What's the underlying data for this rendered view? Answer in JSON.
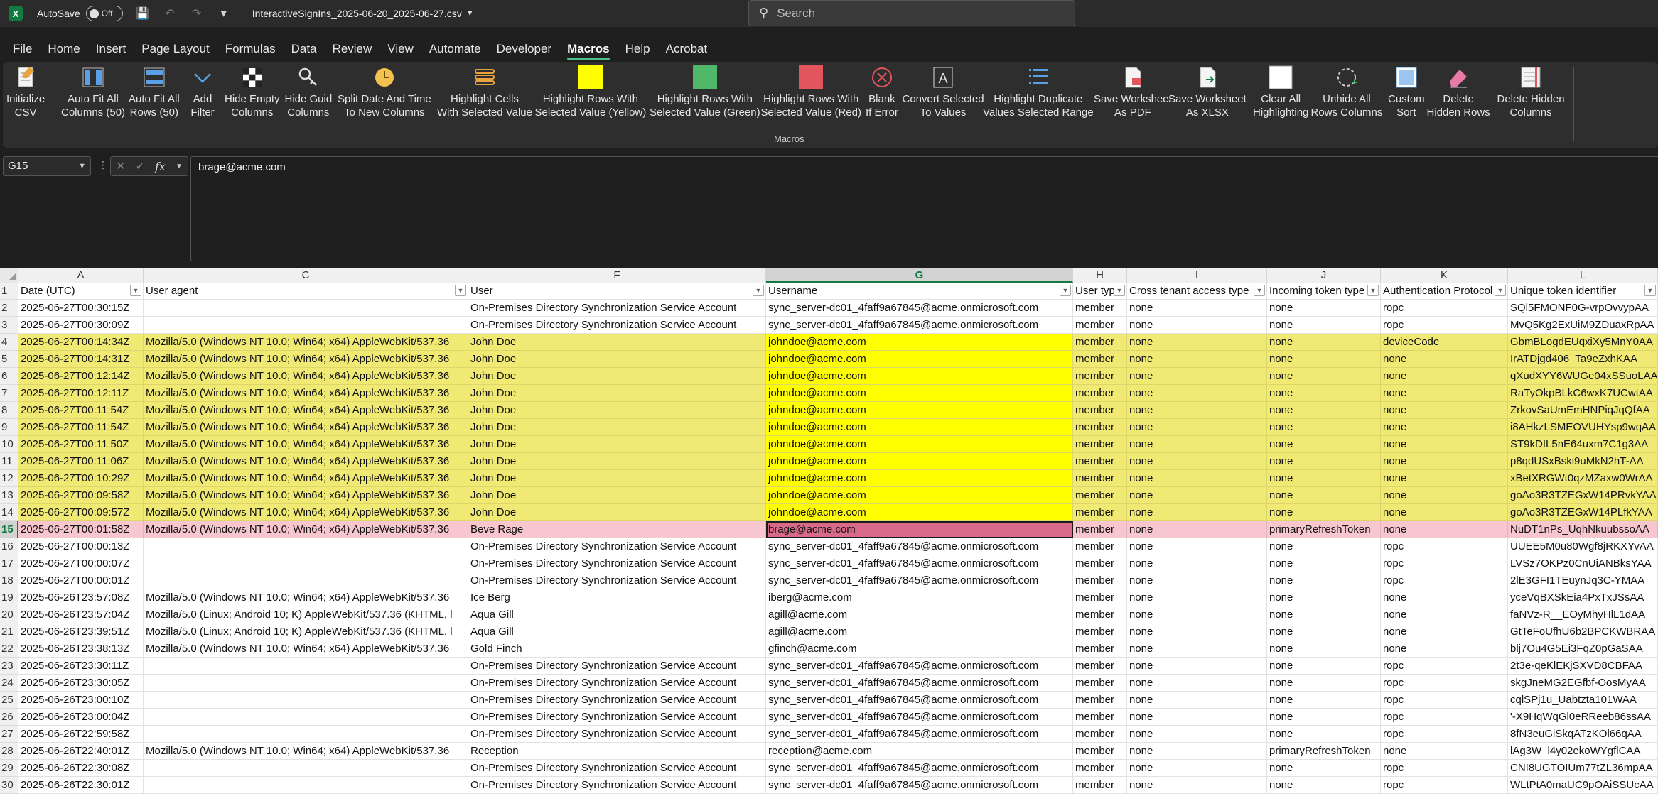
{
  "titlebar": {
    "autosave_label": "AutoSave",
    "autosave_state": "Off",
    "filename": "InteractiveSignIns_2025-06-20_2025-06-27.csv",
    "search_placeholder": "Search"
  },
  "menu": [
    "File",
    "Home",
    "Insert",
    "Page Layout",
    "Formulas",
    "Data",
    "Review",
    "View",
    "Automate",
    "Developer",
    "Macros",
    "Help",
    "Acrobat"
  ],
  "menu_active": "Macros",
  "ribbon": {
    "group_label": "Macros",
    "buttons": [
      {
        "label": "Initialize\nCSV",
        "icon": "doc-initialize-icon"
      },
      {
        "label": "Auto Fit All\nColumns (50)",
        "icon": "fit-columns-icon"
      },
      {
        "label": "Auto Fit All\nRows (50)",
        "icon": "fit-rows-icon"
      },
      {
        "label": "Add\nFilter",
        "icon": "filter-chevron-icon"
      },
      {
        "label": "Hide Empty\nColumns",
        "icon": "checker-icon"
      },
      {
        "label": "Hide Guid\nColumns",
        "icon": "key-icon"
      },
      {
        "label": "Split Date And Time\nTo New Columns",
        "icon": "clock-icon"
      },
      {
        "label": "Highlight Cells\nWith Selected Value",
        "icon": "stack-icon"
      },
      {
        "label": "Highlight Rows With\nSelected Value (Yellow)",
        "icon": "yellow-square-icon"
      },
      {
        "label": "Highlight Rows With\nSelected Value (Green)",
        "icon": "green-square-icon"
      },
      {
        "label": "Highlight Rows With\nSelected Value (Red)",
        "icon": "red-square-icon"
      },
      {
        "label": "Blank\nIf Error",
        "icon": "error-circle-icon"
      },
      {
        "label": "Convert Selected\nTo Values",
        "icon": "text-a-icon"
      },
      {
        "label": "Highlight Duplicate\nValues Selected Range",
        "icon": "list-dup-icon"
      },
      {
        "label": "Save Worksheet\nAs PDF",
        "icon": "pdf-doc-icon"
      },
      {
        "label": "Save Worksheet\nAs XLSX",
        "icon": "xlsx-doc-icon"
      },
      {
        "label": "Clear All\nHighlighting",
        "icon": "blank-square-icon"
      },
      {
        "label": "Unhide All\nRows Columns",
        "icon": "unhide-icon"
      },
      {
        "label": "Custom\nSort",
        "icon": "sort-grid-icon"
      },
      {
        "label": "Delete\nHidden Rows",
        "icon": "eraser-icon"
      },
      {
        "label": "Delete Hidden\nColumns",
        "icon": "sheet-delete-icon"
      }
    ]
  },
  "formula_bar": {
    "name_box": "G15",
    "formula": "brage@acme.com",
    "fx_label": "fx"
  },
  "columns": [
    {
      "letter": "A",
      "header": "Date (UTC)"
    },
    {
      "letter": "C",
      "header": "User agent"
    },
    {
      "letter": "F",
      "header": "User"
    },
    {
      "letter": "G",
      "header": "Username"
    },
    {
      "letter": "H",
      "header": "User type"
    },
    {
      "letter": "I",
      "header": "Cross tenant access type"
    },
    {
      "letter": "J",
      "header": "Incoming token type"
    },
    {
      "letter": "K",
      "header": "Authentication Protocol"
    },
    {
      "letter": "L",
      "header": "Unique token identifier"
    }
  ],
  "selected_cell": {
    "row": 15,
    "col": "G"
  },
  "rows": [
    {
      "n": 2,
      "hl": "",
      "cells": [
        "2025-06-27T00:30:15Z",
        "",
        "On-Premises Directory Synchronization Service Account",
        "sync_server-dc01_4faff9a67845@acme.onmicrosoft.com",
        "member",
        "none",
        "none",
        "ropc",
        "SQl5FMONF0G-vrpOvvypAA"
      ]
    },
    {
      "n": 3,
      "hl": "",
      "cells": [
        "2025-06-27T00:30:09Z",
        "",
        "On-Premises Directory Synchronization Service Account",
        "sync_server-dc01_4faff9a67845@acme.onmicrosoft.com",
        "member",
        "none",
        "none",
        "ropc",
        "MvQ5Kg2ExUiM9ZDuaxRpAA"
      ]
    },
    {
      "n": 4,
      "hl": "yellow",
      "cells": [
        "2025-06-27T00:14:34Z",
        "Mozilla/5.0 (Windows NT 10.0; Win64; x64) AppleWebKit/537.36",
        "John Doe",
        "johndoe@acme.com",
        "member",
        "none",
        "none",
        "deviceCode",
        "GbmBLogdEUqxiXy5MnY0AA"
      ]
    },
    {
      "n": 5,
      "hl": "yellow",
      "cells": [
        "2025-06-27T00:14:31Z",
        "Mozilla/5.0 (Windows NT 10.0; Win64; x64) AppleWebKit/537.36",
        "John Doe",
        "johndoe@acme.com",
        "member",
        "none",
        "none",
        "none",
        "IrATDjgd406_Ta9eZxhKAA"
      ]
    },
    {
      "n": 6,
      "hl": "yellow",
      "cells": [
        "2025-06-27T00:12:14Z",
        "Mozilla/5.0 (Windows NT 10.0; Win64; x64) AppleWebKit/537.36",
        "John Doe",
        "johndoe@acme.com",
        "member",
        "none",
        "none",
        "none",
        "qXudXYY6WUGe04xSSuoLAA"
      ]
    },
    {
      "n": 7,
      "hl": "yellow",
      "cells": [
        "2025-06-27T00:12:11Z",
        "Mozilla/5.0 (Windows NT 10.0; Win64; x64) AppleWebKit/537.36",
        "John Doe",
        "johndoe@acme.com",
        "member",
        "none",
        "none",
        "none",
        "RaTyOkpBLkC6wxK7UCwtAA"
      ]
    },
    {
      "n": 8,
      "hl": "yellow",
      "cells": [
        "2025-06-27T00:11:54Z",
        "Mozilla/5.0 (Windows NT 10.0; Win64; x64) AppleWebKit/537.36",
        "John Doe",
        "johndoe@acme.com",
        "member",
        "none",
        "none",
        "none",
        "ZrkovSaUmEmHNPiqJqQfAA"
      ]
    },
    {
      "n": 9,
      "hl": "yellow",
      "cells": [
        "2025-06-27T00:11:54Z",
        "Mozilla/5.0 (Windows NT 10.0; Win64; x64) AppleWebKit/537.36",
        "John Doe",
        "johndoe@acme.com",
        "member",
        "none",
        "none",
        "none",
        "i8AHkzLSMEOVUHYsp9wqAA"
      ]
    },
    {
      "n": 10,
      "hl": "yellow",
      "cells": [
        "2025-06-27T00:11:50Z",
        "Mozilla/5.0 (Windows NT 10.0; Win64; x64) AppleWebKit/537.36",
        "John Doe",
        "johndoe@acme.com",
        "member",
        "none",
        "none",
        "none",
        "ST9kDIL5nE64uxm7C1g3AA"
      ]
    },
    {
      "n": 11,
      "hl": "yellow",
      "cells": [
        "2025-06-27T00:11:06Z",
        "Mozilla/5.0 (Windows NT 10.0; Win64; x64) AppleWebKit/537.36",
        "John Doe",
        "johndoe@acme.com",
        "member",
        "none",
        "none",
        "none",
        "p8qdUSxBski9uMkN2hT-AA"
      ]
    },
    {
      "n": 12,
      "hl": "yellow",
      "cells": [
        "2025-06-27T00:10:29Z",
        "Mozilla/5.0 (Windows NT 10.0; Win64; x64) AppleWebKit/537.36",
        "John Doe",
        "johndoe@acme.com",
        "member",
        "none",
        "none",
        "none",
        "xBetXRGWt0qzMZaxw0WrAA"
      ]
    },
    {
      "n": 13,
      "hl": "yellow",
      "cells": [
        "2025-06-27T00:09:58Z",
        "Mozilla/5.0 (Windows NT 10.0; Win64; x64) AppleWebKit/537.36",
        "John Doe",
        "johndoe@acme.com",
        "member",
        "none",
        "none",
        "none",
        "goAo3R3TZEGxW14PRvkYAA"
      ]
    },
    {
      "n": 14,
      "hl": "yellow",
      "cells": [
        "2025-06-27T00:09:57Z",
        "Mozilla/5.0 (Windows NT 10.0; Win64; x64) AppleWebKit/537.36",
        "John Doe",
        "johndoe@acme.com",
        "member",
        "none",
        "none",
        "none",
        "goAo3R3TZEGxW14PLfkYAA"
      ]
    },
    {
      "n": 15,
      "hl": "pink",
      "cells": [
        "2025-06-27T00:01:58Z",
        "Mozilla/5.0 (Windows NT 10.0; Win64; x64) AppleWebKit/537.36",
        "Beve Rage",
        "brage@acme.com",
        "member",
        "none",
        "primaryRefreshToken",
        "none",
        "NuDT1nPs_UqhNkuubssoAA"
      ]
    },
    {
      "n": 16,
      "hl": "",
      "cells": [
        "2025-06-27T00:00:13Z",
        "",
        "On-Premises Directory Synchronization Service Account",
        "sync_server-dc01_4faff9a67845@acme.onmicrosoft.com",
        "member",
        "none",
        "none",
        "ropc",
        "UUEE5M0u80Wgf8jRKXYvAA"
      ]
    },
    {
      "n": 17,
      "hl": "",
      "cells": [
        "2025-06-27T00:00:07Z",
        "",
        "On-Premises Directory Synchronization Service Account",
        "sync_server-dc01_4faff9a67845@acme.onmicrosoft.com",
        "member",
        "none",
        "none",
        "ropc",
        "LVSz7OKPz0CnUiANBksYAA"
      ]
    },
    {
      "n": 18,
      "hl": "",
      "cells": [
        "2025-06-27T00:00:01Z",
        "",
        "On-Premises Directory Synchronization Service Account",
        "sync_server-dc01_4faff9a67845@acme.onmicrosoft.com",
        "member",
        "none",
        "none",
        "ropc",
        "2lE3GFI1TEuynJq3C-YMAA"
      ]
    },
    {
      "n": 19,
      "hl": "",
      "cells": [
        "2025-06-26T23:57:08Z",
        "Mozilla/5.0 (Windows NT 10.0; Win64; x64) AppleWebKit/537.36",
        "Ice Berg",
        "iberg@acme.com",
        "member",
        "none",
        "none",
        "none",
        "yceVqBXSkEia4PxTxJSsAA"
      ]
    },
    {
      "n": 20,
      "hl": "",
      "cells": [
        "2025-06-26T23:57:04Z",
        "Mozilla/5.0 (Linux; Android 10; K) AppleWebKit/537.36 (KHTML, l",
        "Aqua Gill",
        "agill@acme.com",
        "member",
        "none",
        "none",
        "none",
        "faNVz-R__EOyMhyHlL1dAA"
      ]
    },
    {
      "n": 21,
      "hl": "",
      "cells": [
        "2025-06-26T23:39:51Z",
        "Mozilla/5.0 (Linux; Android 10; K) AppleWebKit/537.36 (KHTML, l",
        "Aqua Gill",
        "agill@acme.com",
        "member",
        "none",
        "none",
        "none",
        "GtTeFoUfhU6b2BPCKWBRAA"
      ]
    },
    {
      "n": 22,
      "hl": "",
      "cells": [
        "2025-06-26T23:38:13Z",
        "Mozilla/5.0 (Windows NT 10.0; Win64; x64) AppleWebKit/537.36",
        "Gold Finch",
        "gfinch@acme.com",
        "member",
        "none",
        "none",
        "none",
        "blj7Ou4G5Ei3FqZ0pGaSAA"
      ]
    },
    {
      "n": 23,
      "hl": "",
      "cells": [
        "2025-06-26T23:30:11Z",
        "",
        "On-Premises Directory Synchronization Service Account",
        "sync_server-dc01_4faff9a67845@acme.onmicrosoft.com",
        "member",
        "none",
        "none",
        "ropc",
        "2t3e-qeKlEKjSXVD8CBFAA"
      ]
    },
    {
      "n": 24,
      "hl": "",
      "cells": [
        "2025-06-26T23:30:05Z",
        "",
        "On-Premises Directory Synchronization Service Account",
        "sync_server-dc01_4faff9a67845@acme.onmicrosoft.com",
        "member",
        "none",
        "none",
        "ropc",
        "skgJneMG2EGfbf-OosMyAA"
      ]
    },
    {
      "n": 25,
      "hl": "",
      "cells": [
        "2025-06-26T23:00:10Z",
        "",
        "On-Premises Directory Synchronization Service Account",
        "sync_server-dc01_4faff9a67845@acme.onmicrosoft.com",
        "member",
        "none",
        "none",
        "ropc",
        "cqlSPj1u_Uabtzta101WAA"
      ]
    },
    {
      "n": 26,
      "hl": "",
      "cells": [
        "2025-06-26T23:00:04Z",
        "",
        "On-Premises Directory Synchronization Service Account",
        "sync_server-dc01_4faff9a67845@acme.onmicrosoft.com",
        "member",
        "none",
        "none",
        "ropc",
        "'-X9HqWqGl0eRReeb86ssAA"
      ]
    },
    {
      "n": 27,
      "hl": "",
      "cells": [
        "2025-06-26T22:59:58Z",
        "",
        "On-Premises Directory Synchronization Service Account",
        "sync_server-dc01_4faff9a67845@acme.onmicrosoft.com",
        "member",
        "none",
        "none",
        "ropc",
        "8fN3euGiSkqATzKOl66qAA"
      ]
    },
    {
      "n": 28,
      "hl": "",
      "cells": [
        "2025-06-26T22:40:01Z",
        "Mozilla/5.0 (Windows NT 10.0; Win64; x64) AppleWebKit/537.36",
        "Reception",
        "reception@acme.com",
        "member",
        "none",
        "primaryRefreshToken",
        "none",
        "lAg3W_l4y02ekoWYgflCAA"
      ]
    },
    {
      "n": 29,
      "hl": "",
      "cells": [
        "2025-06-26T22:30:08Z",
        "",
        "On-Premises Directory Synchronization Service Account",
        "sync_server-dc01_4faff9a67845@acme.onmicrosoft.com",
        "member",
        "none",
        "none",
        "ropc",
        "CNI8UGTOIUm77tZL36mpAA"
      ]
    },
    {
      "n": 30,
      "hl": "",
      "cells": [
        "2025-06-26T22:30:01Z",
        "",
        "On-Premises Directory Synchronization Service Account",
        "sync_server-dc01_4faff9a67845@acme.onmicrosoft.com",
        "member",
        "none",
        "none",
        "ropc",
        "WLtPtA0maUC9pOAiSSUcAA"
      ]
    }
  ],
  "colors": {
    "row_highlight_yellow": "#f0ea74",
    "username_highlight_yellow": "#ffff00",
    "row_highlight_pink": "#f8c6ce",
    "active_cell": "#d9698a",
    "accent_green": "#107c41"
  }
}
